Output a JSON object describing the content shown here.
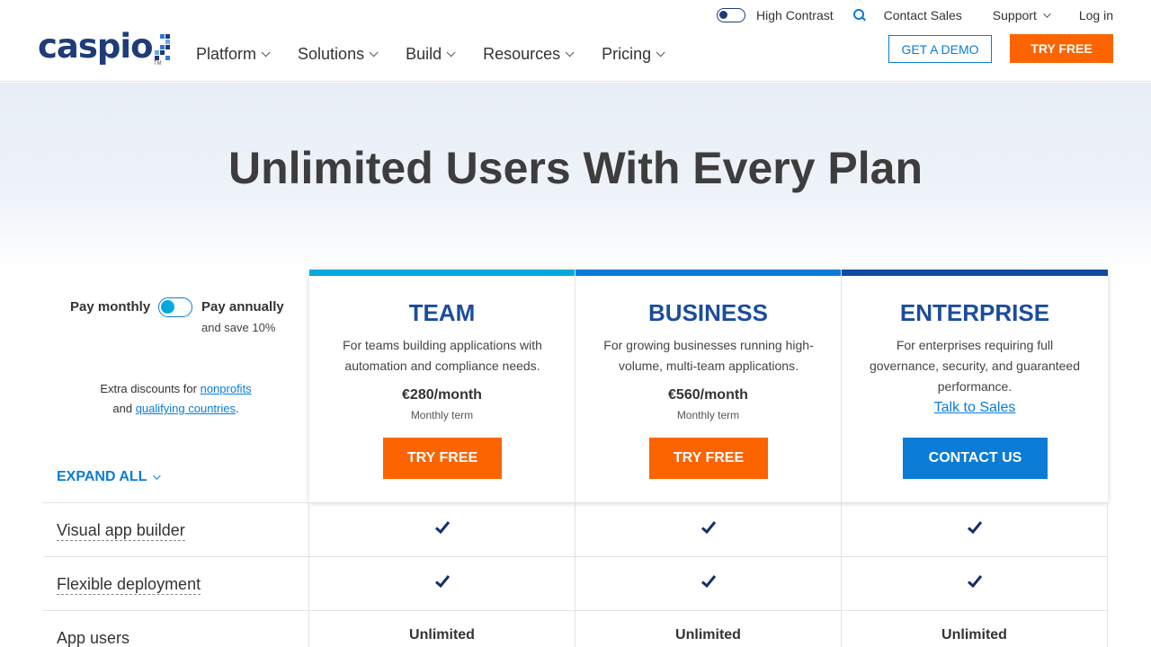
{
  "brand": {
    "name": "caspio",
    "trademark": "TM"
  },
  "nav": {
    "items": [
      {
        "label": "Platform"
      },
      {
        "label": "Solutions"
      },
      {
        "label": "Build"
      },
      {
        "label": "Resources"
      },
      {
        "label": "Pricing"
      }
    ]
  },
  "utility": {
    "high_contrast": "High Contrast",
    "contact_sales": "Contact Sales",
    "support": "Support",
    "login": "Log in"
  },
  "header_buttons": {
    "demo": "GET A DEMO",
    "try_free": "TRY FREE"
  },
  "hero": {
    "title": "Unlimited Users With Every Plan"
  },
  "billing": {
    "monthly_label": "Pay monthly",
    "annual_label": "Pay annually",
    "save_note": "and save 10%",
    "selected": "monthly"
  },
  "discounts": {
    "prefix": "Extra discounts for",
    "link1": "nonprofits",
    "joiner": "and",
    "link2": "qualifying countries",
    "suffix": "."
  },
  "expand_all": "EXPAND ALL",
  "plans": [
    {
      "name": "TEAM",
      "description": "For teams building applications with automation and compliance needs.",
      "price": "€280/month",
      "term": "Monthly term",
      "cta": "TRY FREE",
      "bar_color": "#00aadd"
    },
    {
      "name": "BUSINESS",
      "description": "For growing businesses running high-volume, multi-team applications.",
      "price": "€560/month",
      "term": "Monthly term",
      "cta": "TRY FREE",
      "bar_color": "#0a7cd6"
    },
    {
      "name": "ENTERPRISE",
      "description": "For enterprises requiring full governance, security, and guaranteed performance.",
      "link": "Talk to Sales",
      "cta": "CONTACT US",
      "bar_color": "#0d4ba0"
    }
  ],
  "features": [
    {
      "label": "Visual app builder",
      "values": [
        "check",
        "check",
        "check"
      ]
    },
    {
      "label": "Flexible deployment",
      "values": [
        "check",
        "check",
        "check"
      ]
    },
    {
      "label": "App users",
      "values": [
        "Unlimited",
        "Unlimited",
        "Unlimited"
      ]
    }
  ],
  "colors": {
    "brand_navy": "#1e3c78",
    "accent_blue": "#0a7cd6",
    "cta_orange": "#fb6400",
    "check_navy": "#12306b"
  },
  "icons": [
    "logo-squares-icon",
    "contrast-toggle-icon",
    "search-icon",
    "chevron-down-icon",
    "checkmark-icon"
  ]
}
